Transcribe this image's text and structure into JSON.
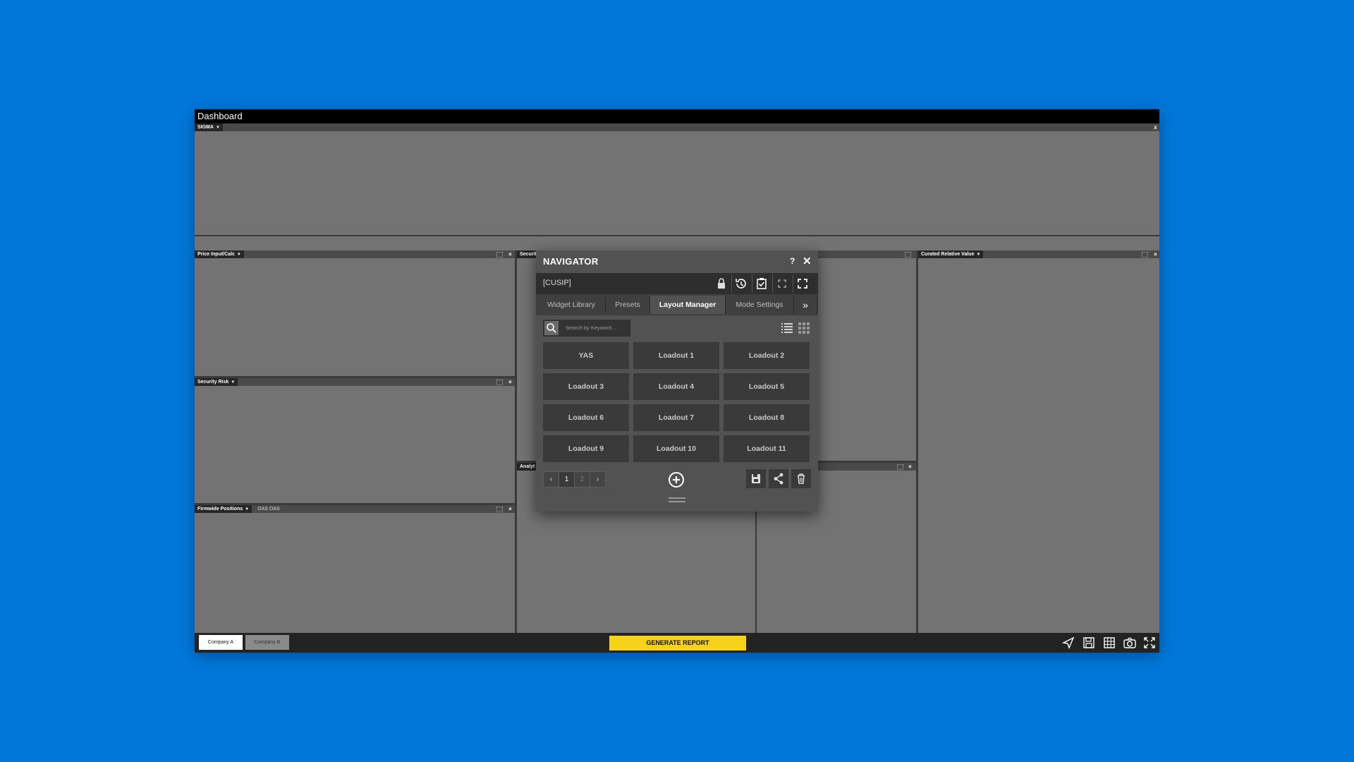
{
  "window": {
    "title": "Dashboard"
  },
  "panels": {
    "sigma": {
      "title": "SIGMA"
    },
    "price_input": {
      "title": "Price Input/Calc"
    },
    "security": {
      "title": "Securit"
    },
    "curated": {
      "title": "Curated Relative Value"
    },
    "security_risk": {
      "title": "Security Risk"
    },
    "analytics": {
      "title": "Analyt"
    },
    "firmwide": {
      "title": "Firmwide Positions",
      "extra": "OAS  OAS"
    }
  },
  "close_glyph": "×",
  "sigma_close": "x",
  "bottom": {
    "tabs": [
      "Company A",
      "Company B"
    ],
    "generate_label": "GENERATE REPORT",
    "icons": [
      "send-icon",
      "save-icon",
      "grid-icon",
      "camera-icon",
      "fullscreen-icon"
    ]
  },
  "navigator": {
    "title": "NAVIGATOR",
    "help": "?",
    "close": "✕",
    "cusip": "[CUSIP]",
    "tabs": [
      "Widget Library",
      "Presets",
      "Layout Manager",
      "Mode Settings"
    ],
    "active_tab": "Layout Manager",
    "more": "»",
    "search_placeholder": "Search by Keyword...",
    "loadouts": [
      "YAS",
      "Loadout 1",
      "Loadout 2",
      "Loadout 3",
      "Loadout 4",
      "Loadout 5",
      "Loadout 6",
      "Loadout 7",
      "Loadout 8",
      "Loadout 9",
      "Loadout 10",
      "Loadout 11"
    ],
    "pages": [
      "1",
      "2"
    ],
    "current_page": "1",
    "prev": "‹",
    "next": "›"
  },
  "colors": {
    "accent": "#f7d21a",
    "background": "#0077d9"
  }
}
